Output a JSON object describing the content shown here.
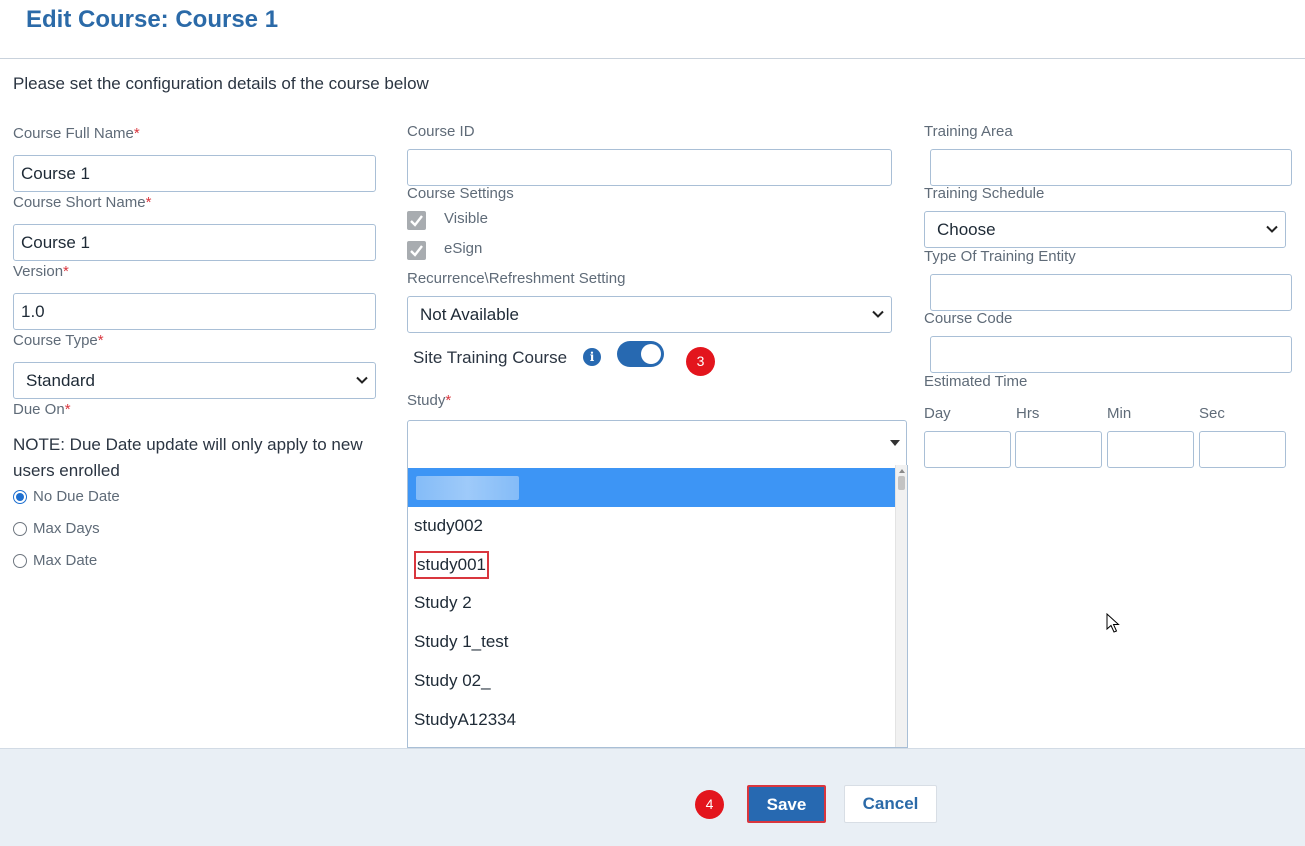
{
  "page": {
    "title": "Edit Course: Course 1",
    "intro": "Please set the configuration details of the course below"
  },
  "left": {
    "full_name_label": "Course Full Name",
    "full_name_value": "Course 1",
    "short_name_label": "Course Short Name",
    "short_name_value": "Course 1",
    "version_label": "Version",
    "version_value": "1.0",
    "course_type_label": "Course Type",
    "course_type_value": "Standard",
    "due_on_label": "Due On",
    "required_marker": "*",
    "note": "NOTE: Due Date update will only apply to new users enrolled",
    "due_options": [
      {
        "label": "No Due Date",
        "selected": true
      },
      {
        "label": "Max Days",
        "selected": false
      },
      {
        "label": "Max Date",
        "selected": false
      }
    ]
  },
  "middle": {
    "course_id_label": "Course ID",
    "course_id_value": "",
    "settings_label": "Course Settings",
    "settings": [
      {
        "label": "Visible",
        "checked": true
      },
      {
        "label": "eSign",
        "checked": true
      }
    ],
    "recurrence_label": "Recurrence\\Refreshment Setting",
    "recurrence_value": "Not Available",
    "site_training_label": "Site Training Course",
    "site_training_on": true,
    "study_label": "Study",
    "study_value": "",
    "study_options": [
      "",
      "study002",
      "study001",
      "Study 2",
      "Study 1_test",
      "Study 02_",
      "StudyA12334"
    ]
  },
  "right": {
    "training_area_label": "Training Area",
    "training_area_value": "",
    "training_schedule_label": "Training Schedule",
    "training_schedule_value": "Choose",
    "entity_type_label": "Type Of Training Entity",
    "entity_type_value": "",
    "course_code_label": "Course Code",
    "course_code_value": "",
    "estimated_time_label": "Estimated Time",
    "time_units": [
      "Day",
      "Hrs",
      "Min",
      "Sec"
    ]
  },
  "annotations": {
    "step3": "3",
    "step4": "4"
  },
  "footer": {
    "save_label": "Save",
    "cancel_label": "Cancel"
  },
  "colors": {
    "accent": "#2769b1",
    "title": "#2b6aa8",
    "highlight": "#3d95f5",
    "annotation": "#e3151d"
  }
}
